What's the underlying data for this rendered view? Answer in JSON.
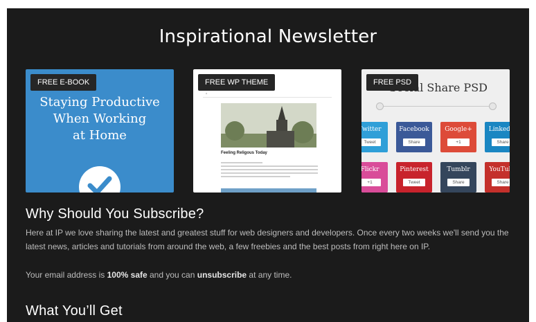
{
  "page": {
    "title": "Inspirational Newsletter"
  },
  "cards": [
    {
      "badge": "FREE E-BOOK",
      "cover_title_lines": [
        "Staying Productive",
        "When Working",
        "at Home"
      ]
    },
    {
      "badge": "FREE WP THEME",
      "preview": {
        "site_title": "on",
        "post_title": "Feeling Religous Today"
      }
    },
    {
      "badge": "FREE PSD",
      "preview": {
        "title": "Social Share PSD",
        "tiles": [
          {
            "name": "Twitter",
            "button": "Tweet",
            "color": "#2f9fd8"
          },
          {
            "name": "Facebook",
            "button": "Share",
            "color": "#3b5998"
          },
          {
            "name": "Google+",
            "button": "+1",
            "color": "#dd4b39"
          },
          {
            "name": "LinkedIn",
            "button": "Share",
            "color": "#1a86c2"
          },
          {
            "name": "Flickr",
            "button": "+1",
            "color": "#d94c99"
          },
          {
            "name": "Pinterest",
            "button": "Tweet",
            "color": "#c8232c"
          },
          {
            "name": "Tumblr",
            "button": "Share",
            "color": "#35465c"
          },
          {
            "name": "YouTube",
            "button": "Share",
            "color": "#c4302b"
          }
        ]
      }
    }
  ],
  "why": {
    "heading": "Why Should You Subscribe?",
    "paragraph1": "Here at IP we love sharing the latest and greatest stuff for web designers and developers. Once every two weeks we'll send you the latest news, articles and tutorials from around the web, a few freebies and the best posts from right here on IP.",
    "p2_pre": "Your email address is ",
    "p2_bold1": "100% safe",
    "p2_mid": " and you can ",
    "p2_bold2": "unsubscribe",
    "p2_post": " at any time."
  },
  "what": {
    "heading": "What You’ll Get"
  },
  "colors": {
    "background": "#1b1b1b",
    "accent": "#2f6fb0"
  }
}
